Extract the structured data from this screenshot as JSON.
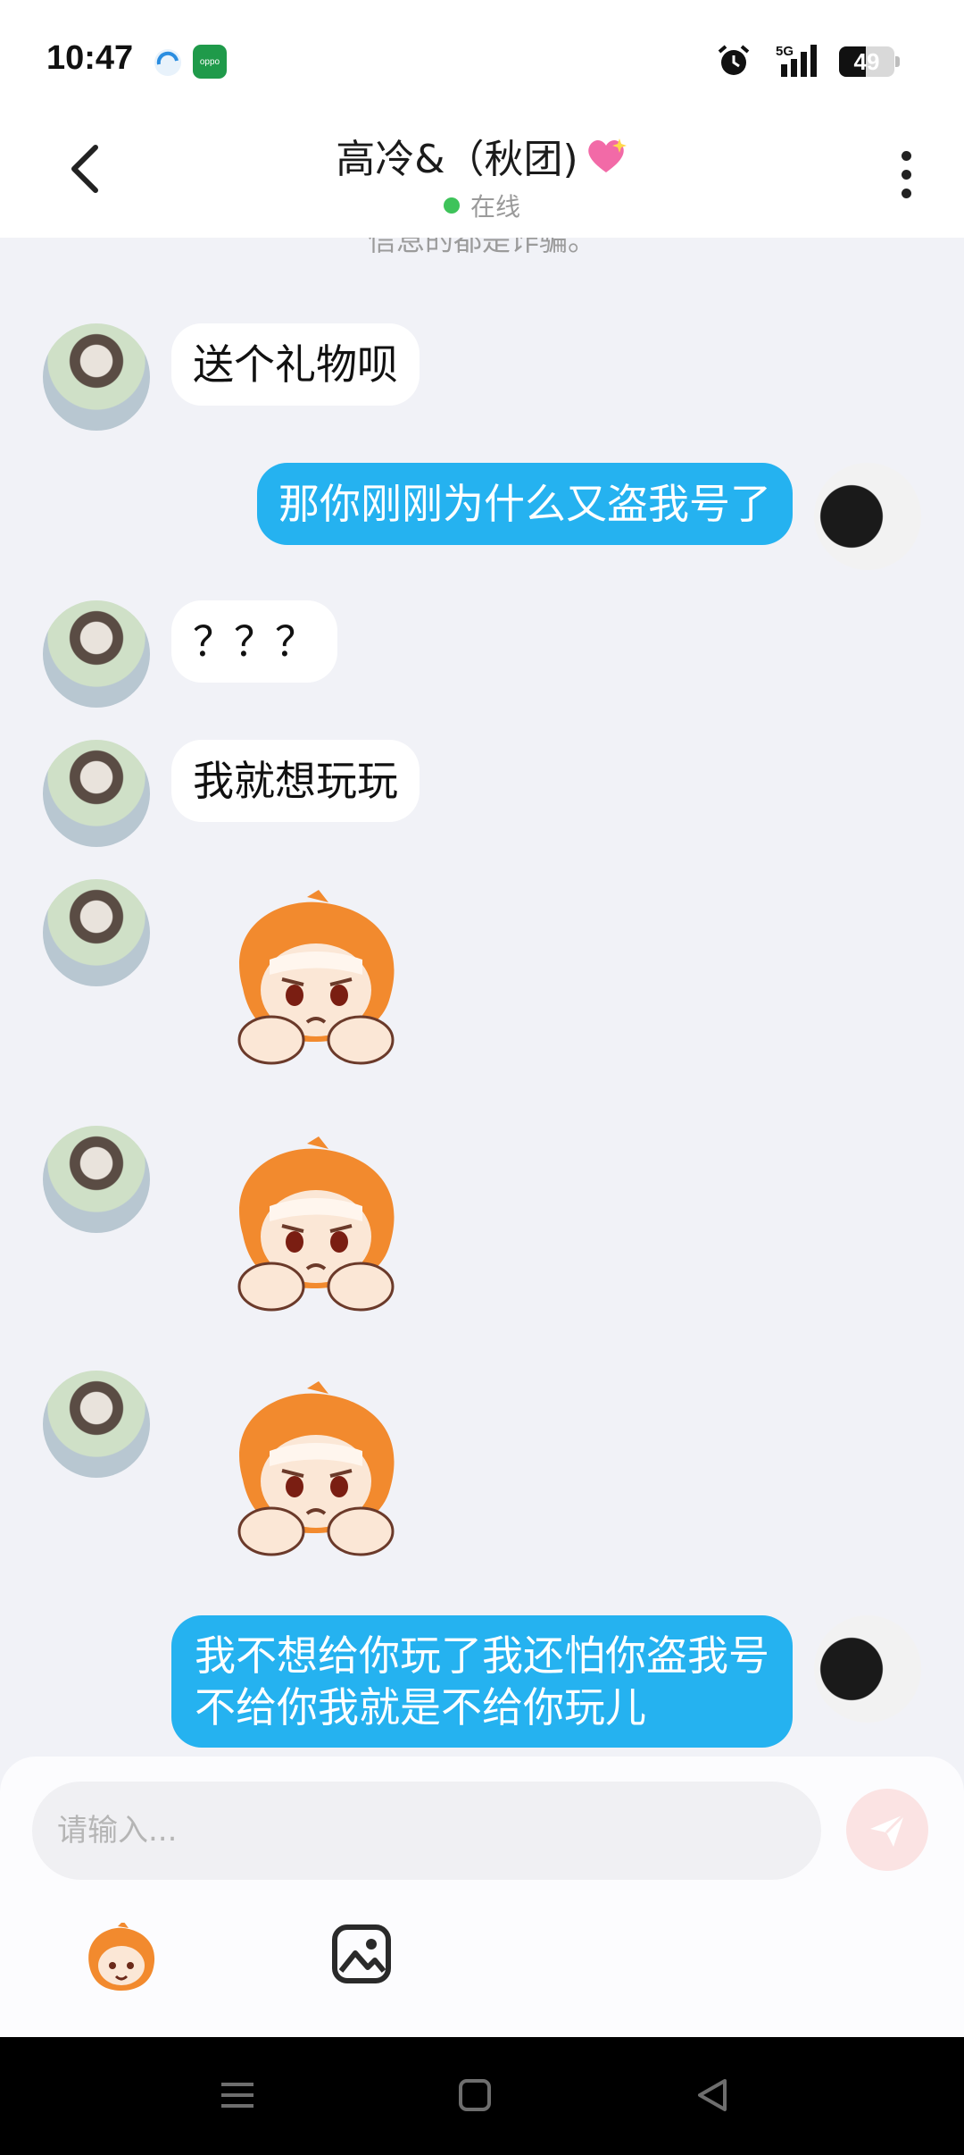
{
  "status_bar": {
    "time": "10:47",
    "network": "5G",
    "battery": "49",
    "battery_level": 0.49,
    "app_icon_b_label": "oppo"
  },
  "header": {
    "title": "高冷&（秋团)",
    "status": "在线",
    "status_color": "#3ec35a"
  },
  "chat": {
    "system_notice": "信息的都是诈骗。",
    "messages": [
      {
        "from": "other",
        "type": "text",
        "text": "送个礼物呗"
      },
      {
        "from": "me",
        "type": "text",
        "text": "那你刚刚为什么又盗我号了"
      },
      {
        "from": "other",
        "type": "text",
        "text": "？？？"
      },
      {
        "from": "other",
        "type": "text",
        "text": "我就想玩玩"
      },
      {
        "from": "other",
        "type": "sticker",
        "sticker": "sad-orange-character"
      },
      {
        "from": "other",
        "type": "sticker",
        "sticker": "sad-orange-character"
      },
      {
        "from": "other",
        "type": "sticker",
        "sticker": "sad-orange-character"
      },
      {
        "from": "me",
        "type": "text",
        "text": "我不想给你玩了我还怕你盗我号",
        "text2": "不给你我就是不给你玩儿"
      }
    ]
  },
  "input": {
    "placeholder": "请输入..."
  },
  "colors": {
    "bubble_me": "#25b2f0",
    "bubble_other": "#ffffff",
    "background": "#f1f2f7"
  },
  "icons": {
    "back": "chevron-left-icon",
    "more": "more-vertical-icon",
    "send": "send-icon",
    "emoji": "emoji-sticker-icon",
    "image": "image-icon"
  }
}
